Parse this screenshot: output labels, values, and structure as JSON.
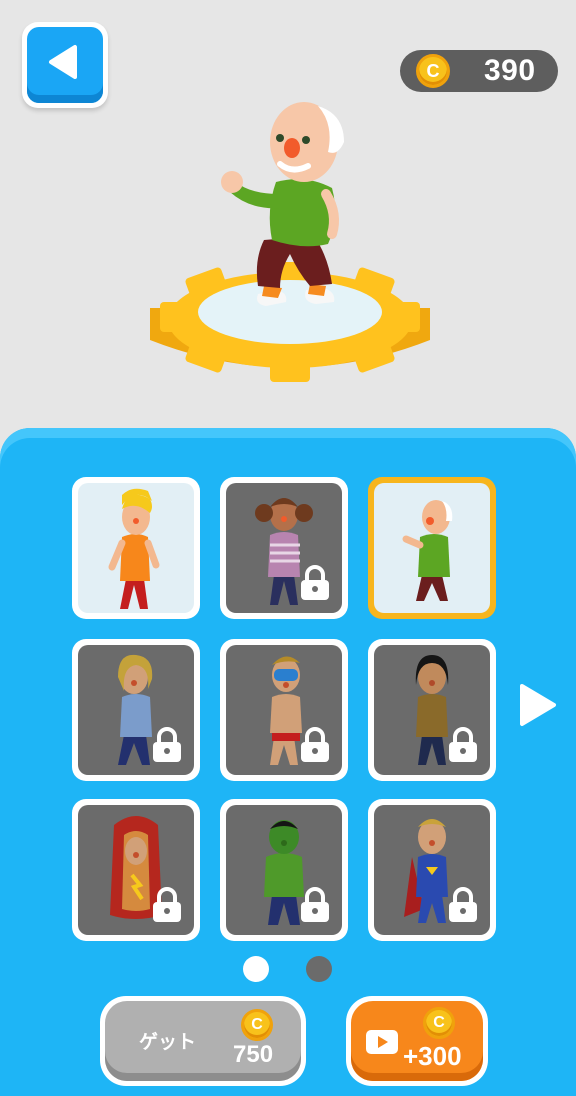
{
  "header": {
    "back_icon": "back-triangle-icon",
    "coin_icon": "coin-icon",
    "coin_symbol": "C",
    "coin_balance": "390"
  },
  "preview": {
    "character": "old-man",
    "pedestal_icon": "gear-pedestal"
  },
  "characters": [
    {
      "id": "blonde-boy",
      "locked": false,
      "selected": false
    },
    {
      "id": "pigtail-girl",
      "locked": true,
      "selected": false
    },
    {
      "id": "old-man",
      "locked": false,
      "selected": true
    },
    {
      "id": "blonde-woman",
      "locked": true,
      "selected": false
    },
    {
      "id": "snorkel-swimmer",
      "locked": true,
      "selected": false
    },
    {
      "id": "dark-hair-woman",
      "locked": true,
      "selected": false
    },
    {
      "id": "hotdog-costume",
      "locked": true,
      "selected": false
    },
    {
      "id": "green-hulk",
      "locked": true,
      "selected": false
    },
    {
      "id": "superhero",
      "locked": true,
      "selected": false
    }
  ],
  "pagination": {
    "pages": 2,
    "current": 1,
    "next_icon": "next-page-arrow-icon"
  },
  "actions": {
    "get_label": "ゲット",
    "get_price": "750",
    "ad_reward": "+300",
    "ad_icon": "video-play-icon"
  },
  "colors": {
    "panel": "#1eb5f6",
    "selected_border": "#f7b51d",
    "coin": "#f8c21b",
    "ad_button": "#f7871b",
    "locked_card": "#6b6b6b"
  }
}
